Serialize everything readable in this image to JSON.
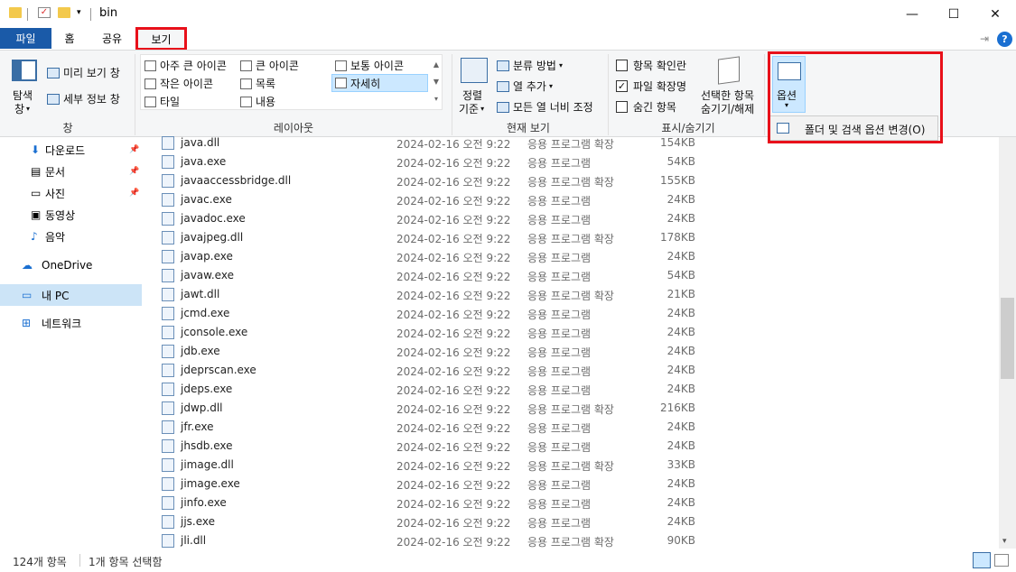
{
  "window": {
    "title": "bin",
    "minimize": "—",
    "maximize": "☐",
    "close": "✕"
  },
  "tabs": {
    "file": "파일",
    "home": "홈",
    "share": "공유",
    "view": "보기"
  },
  "ribbon": {
    "pane": {
      "nav_pane": "탐색",
      "nav_pane2": "창",
      "preview": "미리 보기 창",
      "details": "세부 정보 창",
      "group": "창"
    },
    "layout": {
      "xl": "아주 큰 아이콘",
      "large": "큰 아이콘",
      "medium": "보통 아이콘",
      "small": "작은 아이콘",
      "list": "목록",
      "details": "자세히",
      "tiles": "타일",
      "content": "내용",
      "group": "레이아웃"
    },
    "current": {
      "sort": "정렬",
      "sort2": "기준",
      "groupby": "분류 방법",
      "addcol": "열 추가",
      "fitcols": "모든 열 너비 조정",
      "group": "현재 보기"
    },
    "showhide": {
      "checkboxes": "항목 확인란",
      "extensions": "파일 확장명",
      "hidden": "숨긴 항목",
      "hide_sel": "선택한 항목",
      "hide_sel2": "숨기기/해제",
      "group": "표시/숨기기"
    },
    "options": {
      "label": "옵션",
      "menu_item": "폴더 및 검색 옵션 변경(O)"
    }
  },
  "nav": [
    {
      "label": "다운로드",
      "pin": "📌"
    },
    {
      "label": "문서",
      "pin": "📌"
    },
    {
      "label": "사진",
      "pin": "📌"
    },
    {
      "label": "동영상",
      "pin": ""
    },
    {
      "label": "음악",
      "pin": ""
    },
    {
      "label": "OneDrive",
      "pin": ""
    },
    {
      "label": "내 PC",
      "pin": ""
    },
    {
      "label": "네트워크",
      "pin": ""
    }
  ],
  "files": [
    {
      "name": "java.dll",
      "date": "2024-02-16 오전 9:22",
      "type": "응용 프로그램 확장",
      "size": "154KB"
    },
    {
      "name": "java.exe",
      "date": "2024-02-16 오전 9:22",
      "type": "응용 프로그램",
      "size": "54KB"
    },
    {
      "name": "javaaccessbridge.dll",
      "date": "2024-02-16 오전 9:22",
      "type": "응용 프로그램 확장",
      "size": "155KB"
    },
    {
      "name": "javac.exe",
      "date": "2024-02-16 오전 9:22",
      "type": "응용 프로그램",
      "size": "24KB"
    },
    {
      "name": "javadoc.exe",
      "date": "2024-02-16 오전 9:22",
      "type": "응용 프로그램",
      "size": "24KB"
    },
    {
      "name": "javajpeg.dll",
      "date": "2024-02-16 오전 9:22",
      "type": "응용 프로그램 확장",
      "size": "178KB"
    },
    {
      "name": "javap.exe",
      "date": "2024-02-16 오전 9:22",
      "type": "응용 프로그램",
      "size": "24KB"
    },
    {
      "name": "javaw.exe",
      "date": "2024-02-16 오전 9:22",
      "type": "응용 프로그램",
      "size": "54KB"
    },
    {
      "name": "jawt.dll",
      "date": "2024-02-16 오전 9:22",
      "type": "응용 프로그램 확장",
      "size": "21KB"
    },
    {
      "name": "jcmd.exe",
      "date": "2024-02-16 오전 9:22",
      "type": "응용 프로그램",
      "size": "24KB"
    },
    {
      "name": "jconsole.exe",
      "date": "2024-02-16 오전 9:22",
      "type": "응용 프로그램",
      "size": "24KB"
    },
    {
      "name": "jdb.exe",
      "date": "2024-02-16 오전 9:22",
      "type": "응용 프로그램",
      "size": "24KB"
    },
    {
      "name": "jdeprscan.exe",
      "date": "2024-02-16 오전 9:22",
      "type": "응용 프로그램",
      "size": "24KB"
    },
    {
      "name": "jdeps.exe",
      "date": "2024-02-16 오전 9:22",
      "type": "응용 프로그램",
      "size": "24KB"
    },
    {
      "name": "jdwp.dll",
      "date": "2024-02-16 오전 9:22",
      "type": "응용 프로그램 확장",
      "size": "216KB"
    },
    {
      "name": "jfr.exe",
      "date": "2024-02-16 오전 9:22",
      "type": "응용 프로그램",
      "size": "24KB"
    },
    {
      "name": "jhsdb.exe",
      "date": "2024-02-16 오전 9:22",
      "type": "응용 프로그램",
      "size": "24KB"
    },
    {
      "name": "jimage.dll",
      "date": "2024-02-16 오전 9:22",
      "type": "응용 프로그램 확장",
      "size": "33KB"
    },
    {
      "name": "jimage.exe",
      "date": "2024-02-16 오전 9:22",
      "type": "응용 프로그램",
      "size": "24KB"
    },
    {
      "name": "jinfo.exe",
      "date": "2024-02-16 오전 9:22",
      "type": "응용 프로그램",
      "size": "24KB"
    },
    {
      "name": "jjs.exe",
      "date": "2024-02-16 오전 9:22",
      "type": "응용 프로그램",
      "size": "24KB"
    },
    {
      "name": "jli.dll",
      "date": "2024-02-16 오전 9:22",
      "type": "응용 프로그램 확장",
      "size": "90KB"
    }
  ],
  "status": {
    "count": "124개 항목",
    "selected": "1개 항목 선택함"
  },
  "colors": {
    "accent": "#1a5aa8",
    "highlight": "#e8101a"
  }
}
